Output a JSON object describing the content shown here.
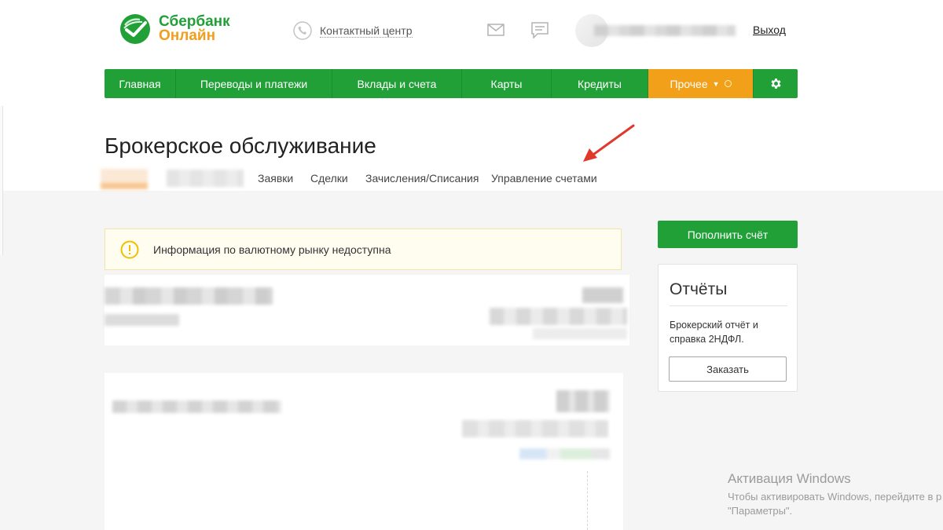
{
  "header": {
    "logo_line1": "Сбербанк",
    "logo_line2": "Онлайн",
    "contact_center": "Контактный центр",
    "logout": "Выход"
  },
  "nav": {
    "items": [
      {
        "label": "Главная"
      },
      {
        "label": "Переводы и платежи"
      },
      {
        "label": "Вклады и счета"
      },
      {
        "label": "Карты"
      },
      {
        "label": "Кредиты"
      },
      {
        "label": "Прочее"
      }
    ]
  },
  "page": {
    "title": "Брокерское обслуживание",
    "tabs": [
      "Заявки",
      "Сделки",
      "Зачисления/Списания",
      "Управление счетами"
    ]
  },
  "alert": {
    "message": "Информация по валютному рынку недоступна"
  },
  "sidebar": {
    "topup_button": "Пополнить счёт",
    "reports_title": "Отчёты",
    "reports_desc": "Брокерский отчёт и справка 2НДФЛ.",
    "order_button": "Заказать"
  },
  "watermark": {
    "line1": "Активация Windows",
    "line2": "Чтобы активировать Windows, перейдите в р",
    "line3": "\"Параметры\"."
  },
  "colors": {
    "brand_green": "#21a038",
    "brand_orange": "#f29d1b",
    "nav_other": "#f2a019",
    "alert_bg": "#fffcf0"
  }
}
